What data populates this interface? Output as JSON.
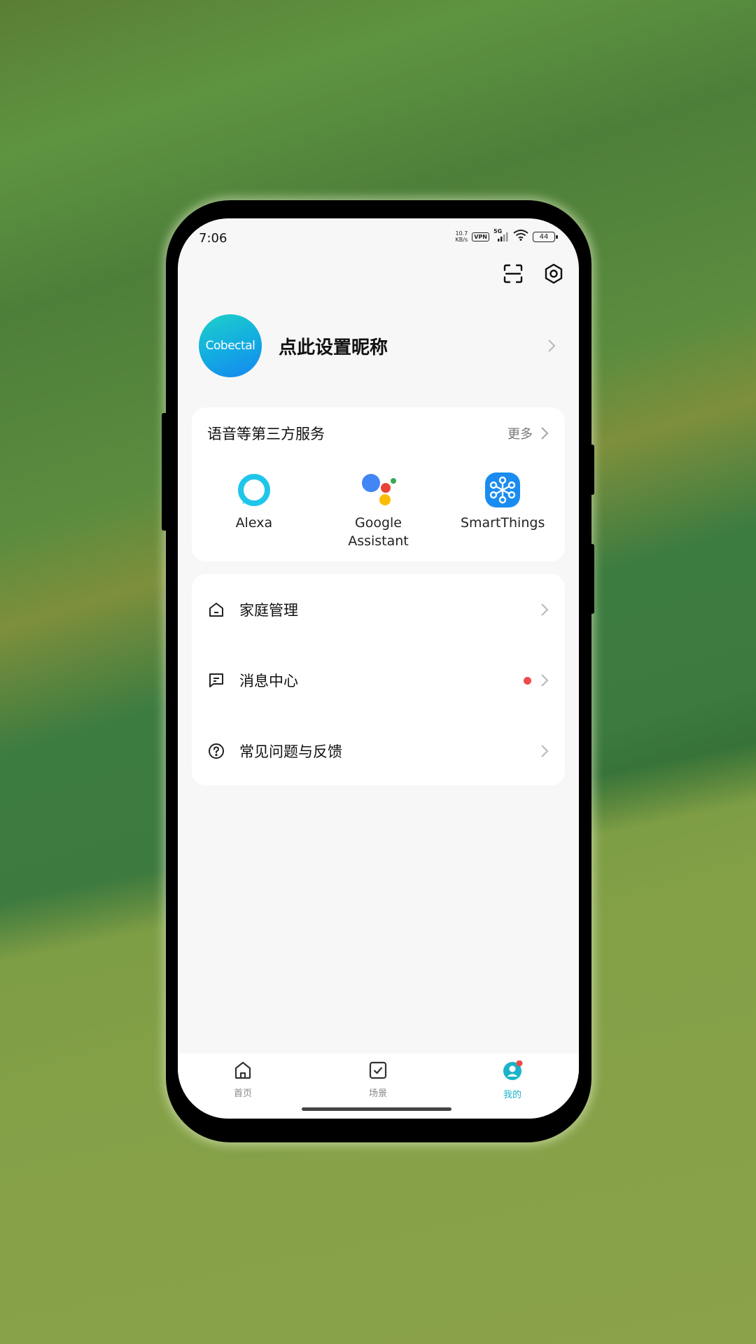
{
  "status_bar": {
    "time": "7:06",
    "net_speed_value": "10.7",
    "net_speed_unit": "KB/s",
    "vpn": "VPN",
    "network": "5G",
    "battery": "44"
  },
  "profile": {
    "avatar_text": "Cobectal",
    "nickname": "点此设置昵称"
  },
  "services": {
    "title": "语音等第三方服务",
    "more": "更多",
    "items": [
      {
        "label": "Alexa",
        "icon": "alexa-icon"
      },
      {
        "label_line1": "Google",
        "label_line2": "Assistant",
        "icon": "google-assistant-icon"
      },
      {
        "label": "SmartThings",
        "icon": "smartthings-icon"
      }
    ]
  },
  "menu": [
    {
      "label": "家庭管理",
      "icon": "house-icon"
    },
    {
      "label": "消息中心",
      "icon": "message-icon",
      "badge": true
    },
    {
      "label": "常见问题与反馈",
      "icon": "help-circle-icon"
    }
  ],
  "tabs": [
    {
      "label": "首页",
      "icon": "home-icon"
    },
    {
      "label": "场景",
      "icon": "checkbox-icon"
    },
    {
      "label": "我的",
      "icon": "user-icon",
      "active": true
    }
  ],
  "colors": {
    "accent": "#1bb3c9",
    "badge": "#ee4b4b",
    "avatar_start": "#1ed0c8",
    "avatar_end": "#1586f0"
  }
}
